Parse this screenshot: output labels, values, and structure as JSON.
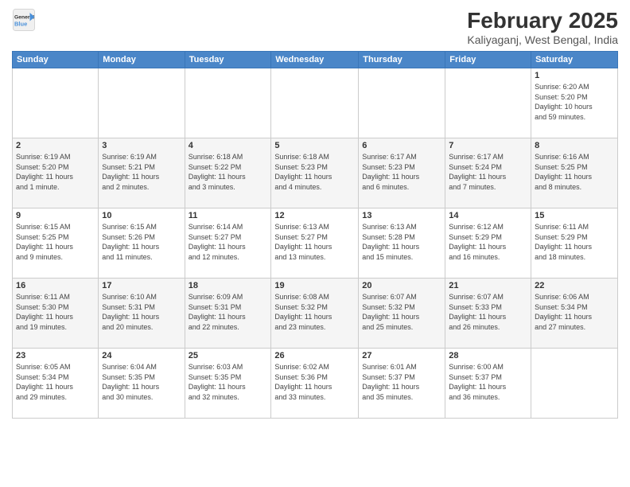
{
  "header": {
    "logo_line1": "General",
    "logo_line2": "Blue",
    "main_title": "February 2025",
    "subtitle": "Kaliyaganj, West Bengal, India"
  },
  "days_of_week": [
    "Sunday",
    "Monday",
    "Tuesday",
    "Wednesday",
    "Thursday",
    "Friday",
    "Saturday"
  ],
  "weeks": [
    [
      {
        "day": "",
        "info": ""
      },
      {
        "day": "",
        "info": ""
      },
      {
        "day": "",
        "info": ""
      },
      {
        "day": "",
        "info": ""
      },
      {
        "day": "",
        "info": ""
      },
      {
        "day": "",
        "info": ""
      },
      {
        "day": "1",
        "info": "Sunrise: 6:20 AM\nSunset: 5:20 PM\nDaylight: 10 hours\nand 59 minutes."
      }
    ],
    [
      {
        "day": "2",
        "info": "Sunrise: 6:19 AM\nSunset: 5:20 PM\nDaylight: 11 hours\nand 1 minute."
      },
      {
        "day": "3",
        "info": "Sunrise: 6:19 AM\nSunset: 5:21 PM\nDaylight: 11 hours\nand 2 minutes."
      },
      {
        "day": "4",
        "info": "Sunrise: 6:18 AM\nSunset: 5:22 PM\nDaylight: 11 hours\nand 3 minutes."
      },
      {
        "day": "5",
        "info": "Sunrise: 6:18 AM\nSunset: 5:23 PM\nDaylight: 11 hours\nand 4 minutes."
      },
      {
        "day": "6",
        "info": "Sunrise: 6:17 AM\nSunset: 5:23 PM\nDaylight: 11 hours\nand 6 minutes."
      },
      {
        "day": "7",
        "info": "Sunrise: 6:17 AM\nSunset: 5:24 PM\nDaylight: 11 hours\nand 7 minutes."
      },
      {
        "day": "8",
        "info": "Sunrise: 6:16 AM\nSunset: 5:25 PM\nDaylight: 11 hours\nand 8 minutes."
      }
    ],
    [
      {
        "day": "9",
        "info": "Sunrise: 6:15 AM\nSunset: 5:25 PM\nDaylight: 11 hours\nand 9 minutes."
      },
      {
        "day": "10",
        "info": "Sunrise: 6:15 AM\nSunset: 5:26 PM\nDaylight: 11 hours\nand 11 minutes."
      },
      {
        "day": "11",
        "info": "Sunrise: 6:14 AM\nSunset: 5:27 PM\nDaylight: 11 hours\nand 12 minutes."
      },
      {
        "day": "12",
        "info": "Sunrise: 6:13 AM\nSunset: 5:27 PM\nDaylight: 11 hours\nand 13 minutes."
      },
      {
        "day": "13",
        "info": "Sunrise: 6:13 AM\nSunset: 5:28 PM\nDaylight: 11 hours\nand 15 minutes."
      },
      {
        "day": "14",
        "info": "Sunrise: 6:12 AM\nSunset: 5:29 PM\nDaylight: 11 hours\nand 16 minutes."
      },
      {
        "day": "15",
        "info": "Sunrise: 6:11 AM\nSunset: 5:29 PM\nDaylight: 11 hours\nand 18 minutes."
      }
    ],
    [
      {
        "day": "16",
        "info": "Sunrise: 6:11 AM\nSunset: 5:30 PM\nDaylight: 11 hours\nand 19 minutes."
      },
      {
        "day": "17",
        "info": "Sunrise: 6:10 AM\nSunset: 5:31 PM\nDaylight: 11 hours\nand 20 minutes."
      },
      {
        "day": "18",
        "info": "Sunrise: 6:09 AM\nSunset: 5:31 PM\nDaylight: 11 hours\nand 22 minutes."
      },
      {
        "day": "19",
        "info": "Sunrise: 6:08 AM\nSunset: 5:32 PM\nDaylight: 11 hours\nand 23 minutes."
      },
      {
        "day": "20",
        "info": "Sunrise: 6:07 AM\nSunset: 5:32 PM\nDaylight: 11 hours\nand 25 minutes."
      },
      {
        "day": "21",
        "info": "Sunrise: 6:07 AM\nSunset: 5:33 PM\nDaylight: 11 hours\nand 26 minutes."
      },
      {
        "day": "22",
        "info": "Sunrise: 6:06 AM\nSunset: 5:34 PM\nDaylight: 11 hours\nand 27 minutes."
      }
    ],
    [
      {
        "day": "23",
        "info": "Sunrise: 6:05 AM\nSunset: 5:34 PM\nDaylight: 11 hours\nand 29 minutes."
      },
      {
        "day": "24",
        "info": "Sunrise: 6:04 AM\nSunset: 5:35 PM\nDaylight: 11 hours\nand 30 minutes."
      },
      {
        "day": "25",
        "info": "Sunrise: 6:03 AM\nSunset: 5:35 PM\nDaylight: 11 hours\nand 32 minutes."
      },
      {
        "day": "26",
        "info": "Sunrise: 6:02 AM\nSunset: 5:36 PM\nDaylight: 11 hours\nand 33 minutes."
      },
      {
        "day": "27",
        "info": "Sunrise: 6:01 AM\nSunset: 5:37 PM\nDaylight: 11 hours\nand 35 minutes."
      },
      {
        "day": "28",
        "info": "Sunrise: 6:00 AM\nSunset: 5:37 PM\nDaylight: 11 hours\nand 36 minutes."
      },
      {
        "day": "",
        "info": ""
      }
    ]
  ]
}
